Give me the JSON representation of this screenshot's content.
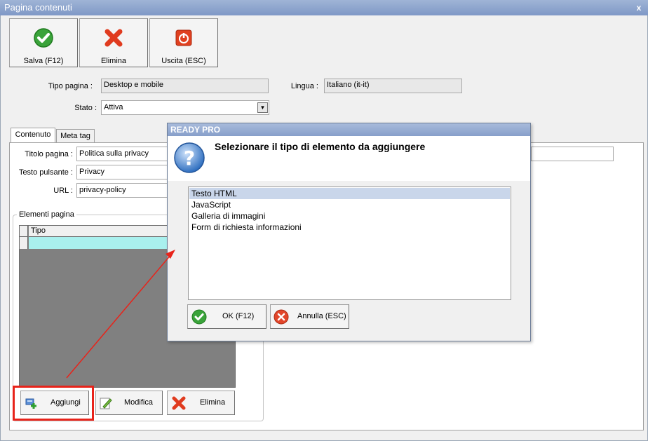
{
  "window": {
    "title": "Pagina contenuti",
    "close": "x"
  },
  "toolbar": {
    "save_label": "Salva (F12)",
    "delete_label": "Elimina",
    "exit_label": "Uscita (ESC)"
  },
  "form": {
    "page_type_label": "Tipo pagina :",
    "page_type_value": "Desktop e mobile",
    "language_label": "Lingua :",
    "language_value": "Italiano (it-it)",
    "state_label": "Stato :",
    "state_value": "Attiva"
  },
  "tabs": [
    {
      "label": "Contenuto"
    },
    {
      "label": "Meta tag"
    }
  ],
  "content": {
    "title_label": "Titolo pagina :",
    "title_value": "Politica sulla privacy",
    "button_text_label": "Testo pulsante :",
    "button_text_value": "Privacy",
    "url_label": "URL :",
    "url_value": "privacy-policy"
  },
  "elements": {
    "group_label": "Elementi pagina",
    "column_header": "Tipo",
    "add_label": "Aggiungi",
    "edit_label": "Modifica",
    "delete_label": "Elimina"
  },
  "dialog": {
    "title": "READY PRO",
    "message": "Selezionare il tipo di elemento da aggiungere",
    "options": [
      {
        "label": "Testo HTML",
        "selected": true
      },
      {
        "label": "JavaScript"
      },
      {
        "label": "Galleria di immagini"
      },
      {
        "label": "Form di richiesta informazioni"
      }
    ],
    "ok_label": "OK (F12)",
    "cancel_label": "Annulla (ESC)"
  },
  "icons": {
    "save": "check-icon",
    "delete": "red-x-icon",
    "exit": "power-icon",
    "question": "question-icon",
    "add": "add-element-icon",
    "edit": "edit-icon"
  },
  "colors": {
    "accent_green": "#3aa33a",
    "accent_red": "#e03b1f",
    "highlight_red": "#e8231a",
    "grid_gray": "#808080",
    "grid_new_row": "#a9f0ee"
  }
}
